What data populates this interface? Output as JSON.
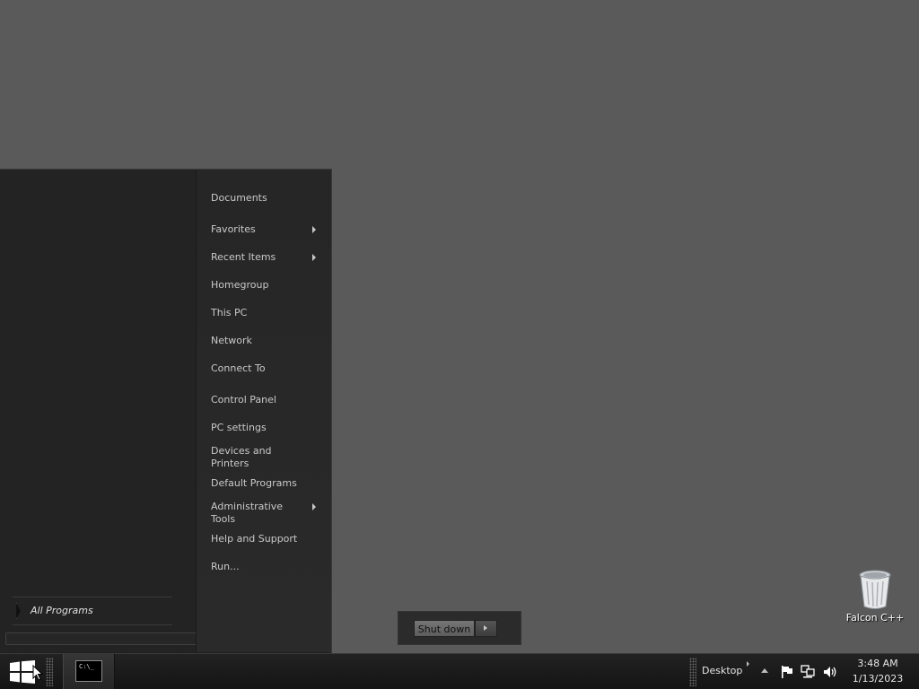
{
  "start_menu": {
    "right_items": [
      {
        "label": "Documents",
        "has_submenu": false
      },
      {
        "label": "Favorites",
        "has_submenu": true
      },
      {
        "label": "Recent Items",
        "has_submenu": true
      },
      {
        "label": "Homegroup",
        "has_submenu": false
      },
      {
        "label": "This PC",
        "has_submenu": false
      },
      {
        "label": "Network",
        "has_submenu": false
      },
      {
        "label": "Connect To",
        "has_submenu": false
      },
      {
        "label": "Control Panel",
        "has_submenu": false
      },
      {
        "label": "PC settings",
        "has_submenu": false
      },
      {
        "label": "Devices and\nPrinters",
        "has_submenu": false
      },
      {
        "label": "Default Programs",
        "has_submenu": false
      },
      {
        "label": "Administrative\nTools",
        "has_submenu": true
      },
      {
        "label": "Help and Support",
        "has_submenu": false
      },
      {
        "label": "Run...",
        "has_submenu": false
      }
    ],
    "all_programs_label": "All Programs",
    "shutdown_label": "Shut down"
  },
  "desktop": {
    "icons": [
      {
        "label": "Falcon C++",
        "icon": "recycle-bin-icon"
      }
    ]
  },
  "taskbar": {
    "start_icon": "windows-logo-icon",
    "running_apps": [
      {
        "icon": "command-prompt-icon",
        "glyph": "C:\\_"
      }
    ],
    "toolbar_label": "Desktop",
    "tray_icons": [
      "action-center-flag-icon",
      "network-icon",
      "volume-icon"
    ],
    "clock": {
      "time": "3:48 AM",
      "date": "1/13/2023"
    }
  },
  "colors": {
    "desktop_bg": "#5a5a5a",
    "menu_bg": "#232323",
    "menu_text": "#c9c9c9",
    "taskbar_bg": "#1b1b1b"
  }
}
